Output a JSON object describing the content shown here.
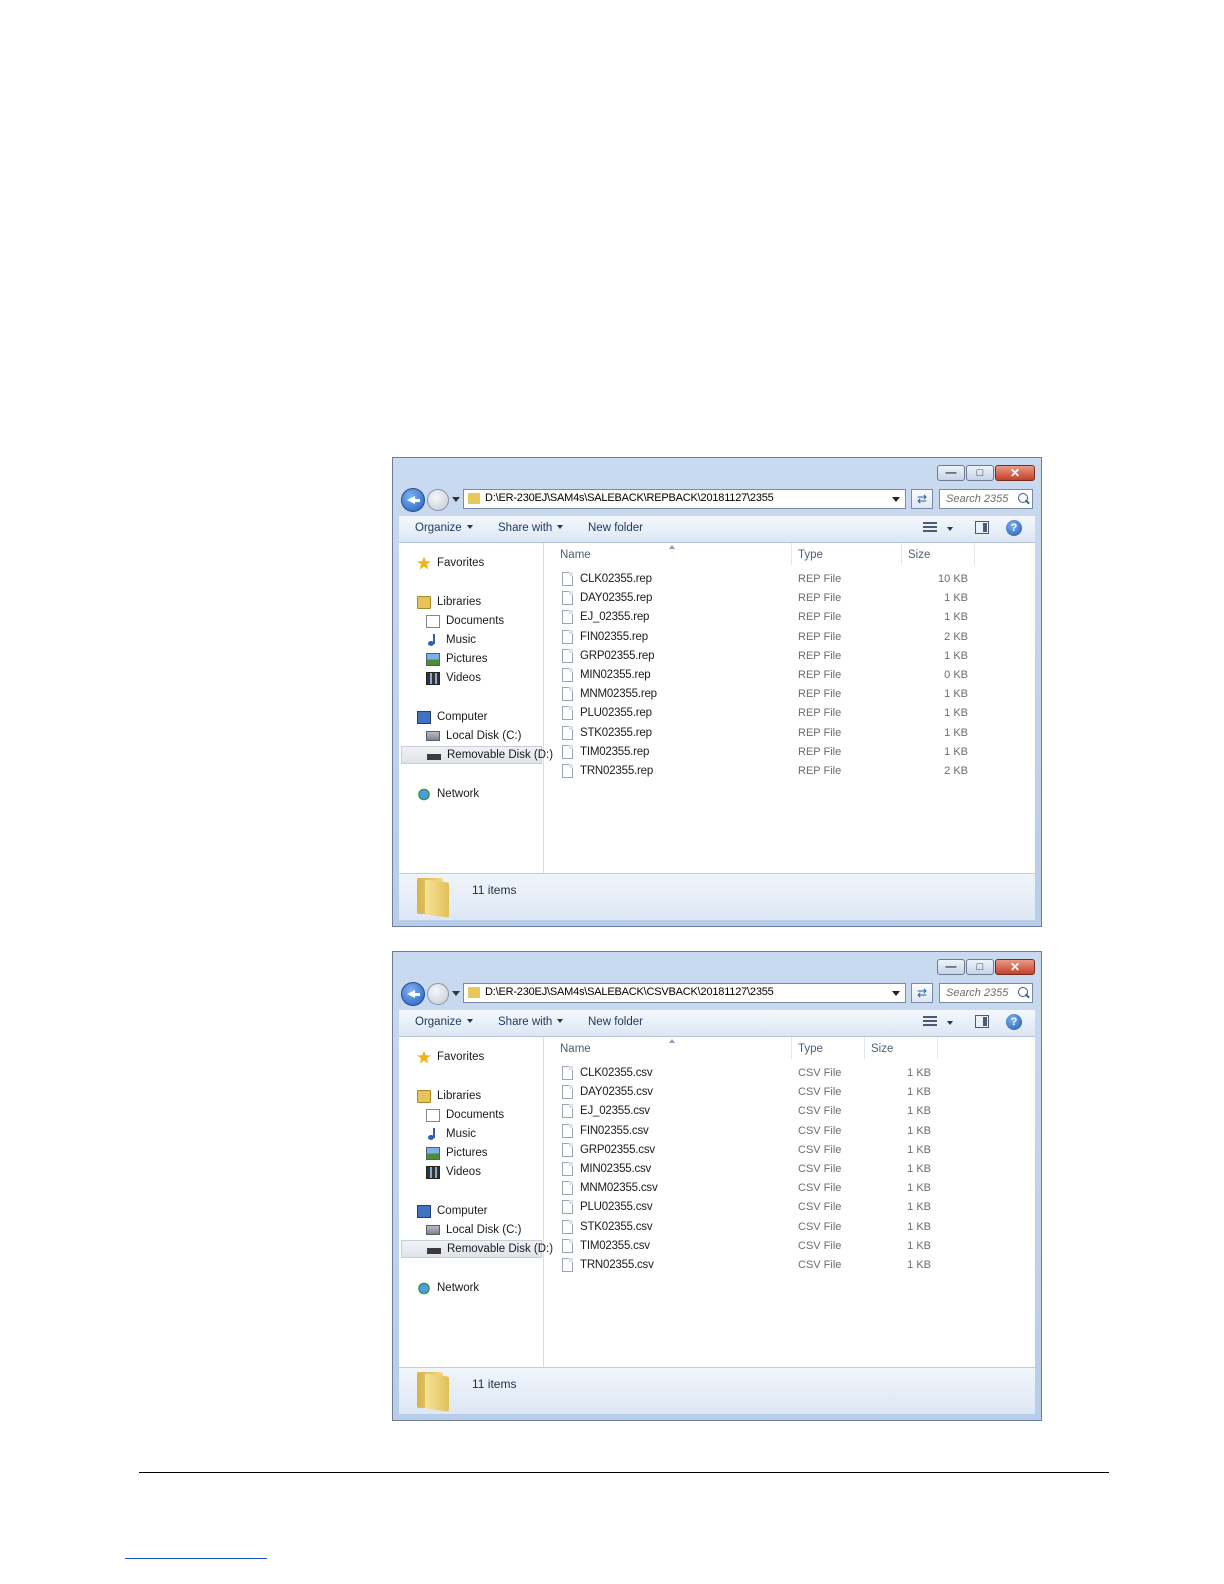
{
  "windows": [
    {
      "address_path": "D:\\ER-230EJ\\SAM4s\\SALEBACK\\REPBACK\\20181127\\2355",
      "search_placeholder": "Search 2355",
      "toolbar": {
        "organize": "Organize",
        "share_with": "Share with",
        "new_folder": "New folder"
      },
      "columns": {
        "name": "Name",
        "type": "Type",
        "size": "Size"
      },
      "nav": {
        "favorites": "Favorites",
        "libraries": "Libraries",
        "documents": "Documents",
        "music": "Music",
        "pictures": "Pictures",
        "videos": "Videos",
        "computer": "Computer",
        "local_disk": "Local Disk (C:)",
        "removable_disk": "Removable Disk (D:)",
        "network": "Network"
      },
      "files": [
        {
          "name": "CLK02355.rep",
          "type": "REP File",
          "size": "10 KB"
        },
        {
          "name": "DAY02355.rep",
          "type": "REP File",
          "size": "1 KB"
        },
        {
          "name": "EJ_02355.rep",
          "type": "REP File",
          "size": "1 KB"
        },
        {
          "name": "FIN02355.rep",
          "type": "REP File",
          "size": "2 KB"
        },
        {
          "name": "GRP02355.rep",
          "type": "REP File",
          "size": "1 KB"
        },
        {
          "name": "MIN02355.rep",
          "type": "REP File",
          "size": "0 KB"
        },
        {
          "name": "MNM02355.rep",
          "type": "REP File",
          "size": "1 KB"
        },
        {
          "name": "PLU02355.rep",
          "type": "REP File",
          "size": "1 KB"
        },
        {
          "name": "STK02355.rep",
          "type": "REP File",
          "size": "1 KB"
        },
        {
          "name": "TIM02355.rep",
          "type": "REP File",
          "size": "1 KB"
        },
        {
          "name": "TRN02355.rep",
          "type": "REP File",
          "size": "2 KB"
        }
      ],
      "status": "11 items"
    },
    {
      "address_path": "D:\\ER-230EJ\\SAM4s\\SALEBACK\\CSVBACK\\20181127\\2355",
      "search_placeholder": "Search 2355",
      "toolbar": {
        "organize": "Organize",
        "share_with": "Share with",
        "new_folder": "New folder"
      },
      "columns": {
        "name": "Name",
        "type": "Type",
        "size": "Size"
      },
      "nav": {
        "favorites": "Favorites",
        "libraries": "Libraries",
        "documents": "Documents",
        "music": "Music",
        "pictures": "Pictures",
        "videos": "Videos",
        "computer": "Computer",
        "local_disk": "Local Disk (C:)",
        "removable_disk": "Removable Disk (D:)",
        "network": "Network"
      },
      "files": [
        {
          "name": "CLK02355.csv",
          "type": "CSV File",
          "size": "1 KB"
        },
        {
          "name": "DAY02355.csv",
          "type": "CSV File",
          "size": "1 KB"
        },
        {
          "name": "EJ_02355.csv",
          "type": "CSV File",
          "size": "1 KB"
        },
        {
          "name": "FIN02355.csv",
          "type": "CSV File",
          "size": "1 KB"
        },
        {
          "name": "GRP02355.csv",
          "type": "CSV File",
          "size": "1 KB"
        },
        {
          "name": "MIN02355.csv",
          "type": "CSV File",
          "size": "1 KB"
        },
        {
          "name": "MNM02355.csv",
          "type": "CSV File",
          "size": "1 KB"
        },
        {
          "name": "PLU02355.csv",
          "type": "CSV File",
          "size": "1 KB"
        },
        {
          "name": "STK02355.csv",
          "type": "CSV File",
          "size": "1 KB"
        },
        {
          "name": "TIM02355.csv",
          "type": "CSV File",
          "size": "1 KB"
        },
        {
          "name": "TRN02355.csv",
          "type": "CSV File",
          "size": "1 KB"
        }
      ],
      "status": "11 items"
    }
  ]
}
